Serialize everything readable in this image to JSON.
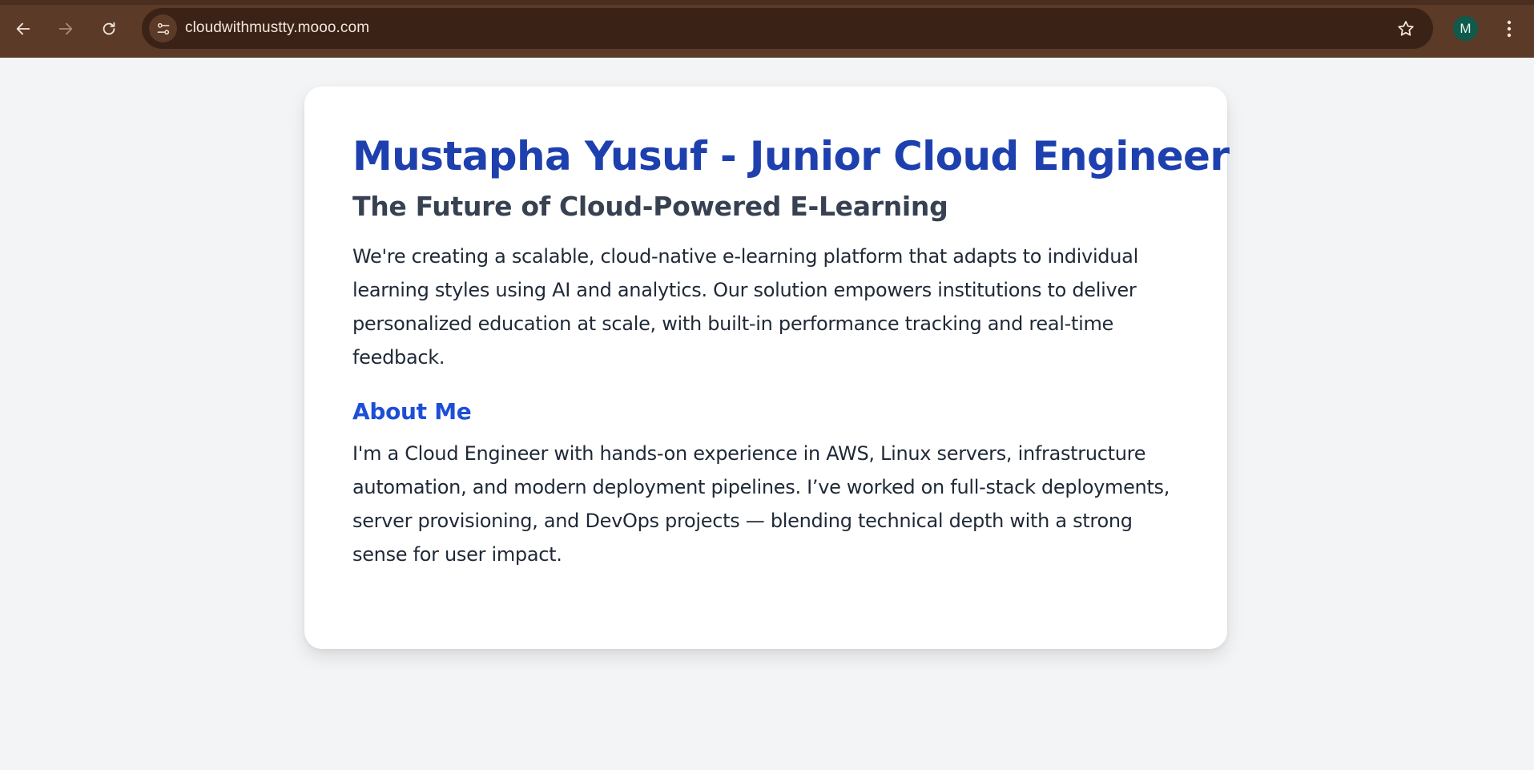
{
  "browser": {
    "url": "cloudwithmustty.mooo.com",
    "avatar_initial": "M",
    "chrome_color": "#5b3a28",
    "omnibox_color": "#3a2216",
    "icons": {
      "back": "arrow-left-icon",
      "forward": "arrow-right-icon",
      "reload": "reload-icon",
      "site_info": "tune-icon",
      "bookmark": "star-icon",
      "menu": "more-vert-icon"
    }
  },
  "page": {
    "title": "Mustapha Yusuf - Junior Cloud Engineer",
    "subtitle": "The Future of Cloud-Powered E-Learning",
    "intro_paragraph": "We're creating a scalable, cloud-native e-learning platform that adapts to individual learning styles using AI and analytics. Our solution empowers institutions to deliver personalized education at scale, with built-in performance tracking and real-time feedback.",
    "about_heading": "About Me",
    "about_paragraph": "I'm a Cloud Engineer with hands-on experience in AWS, Linux servers, infrastructure automation, and modern deployment pipelines. I’ve worked on full-stack deployments, server provisioning, and DevOps projects — blending technical depth with a strong sense for user impact.",
    "colors": {
      "title": "#1e40af",
      "subtitle": "#374151",
      "heading": "#1d4ed8",
      "body": "#1f2937",
      "background": "#f3f4f6",
      "card": "#ffffff"
    }
  }
}
